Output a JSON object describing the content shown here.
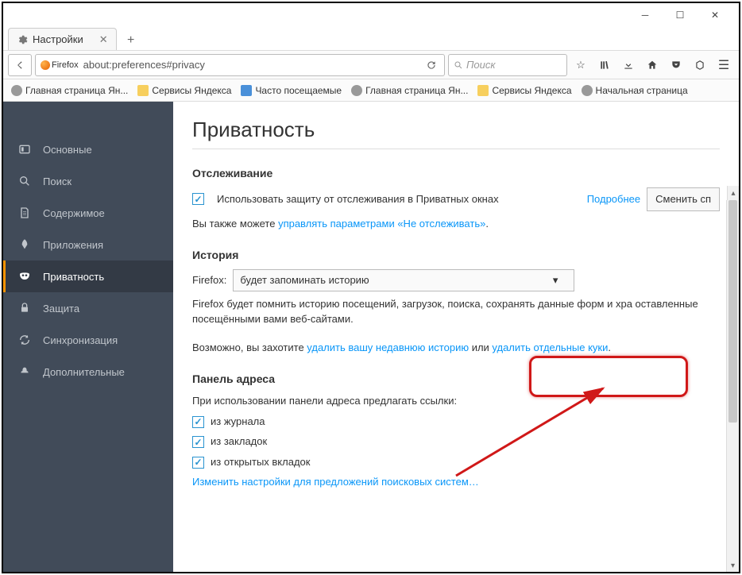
{
  "window": {
    "tab_title": "Настройки",
    "url": "about:preferences#privacy",
    "brand": "Firefox",
    "search_placeholder": "Поиск"
  },
  "bookmarks": [
    {
      "label": "Главная страница Ян...",
      "icon": "globe"
    },
    {
      "label": "Сервисы Яндекса",
      "icon": "folder"
    },
    {
      "label": "Часто посещаемые",
      "icon": "blue"
    },
    {
      "label": "Главная страница Ян...",
      "icon": "globe"
    },
    {
      "label": "Сервисы Яндекса",
      "icon": "folder"
    },
    {
      "label": "Начальная страница",
      "icon": "globe"
    }
  ],
  "sidebar": {
    "items": [
      {
        "label": "Основные"
      },
      {
        "label": "Поиск"
      },
      {
        "label": "Содержимое"
      },
      {
        "label": "Приложения"
      },
      {
        "label": "Приватность"
      },
      {
        "label": "Защита"
      },
      {
        "label": "Синхронизация"
      },
      {
        "label": "Дополнительные"
      }
    ]
  },
  "page": {
    "title": "Приватность",
    "tracking": {
      "heading": "Отслеживание",
      "checkbox_label": "Использовать защиту от отслеживания в Приватных окнах",
      "more_link": "Подробнее",
      "change_button": "Сменить сп",
      "also_text_pre": "Вы также можете ",
      "also_link": "управлять параметрами «Не отслеживать»",
      "also_text_post": "."
    },
    "history": {
      "heading": "История",
      "selector_label": "Firefox:",
      "selector_value": "будет запоминать историю",
      "desc": "Firefox будет помнить историю посещений, загрузок, поиска, сохранять данные форм и хра оставленные посещёнными вами веб-сайтами.",
      "maybe_pre": "Возможно, вы захотите ",
      "link1": "удалить вашу недавнюю историю",
      "mid": " или ",
      "link2": "удалить отдельные куки",
      "post": "."
    },
    "addressbar": {
      "heading": "Панель адреса",
      "intro": "При использовании панели адреса предлагать ссылки:",
      "opt1": "из журнала",
      "opt2": "из закладок",
      "opt3": "из открытых вкладок",
      "change_link": "Изменить настройки для предложений поисковых систем…"
    }
  }
}
